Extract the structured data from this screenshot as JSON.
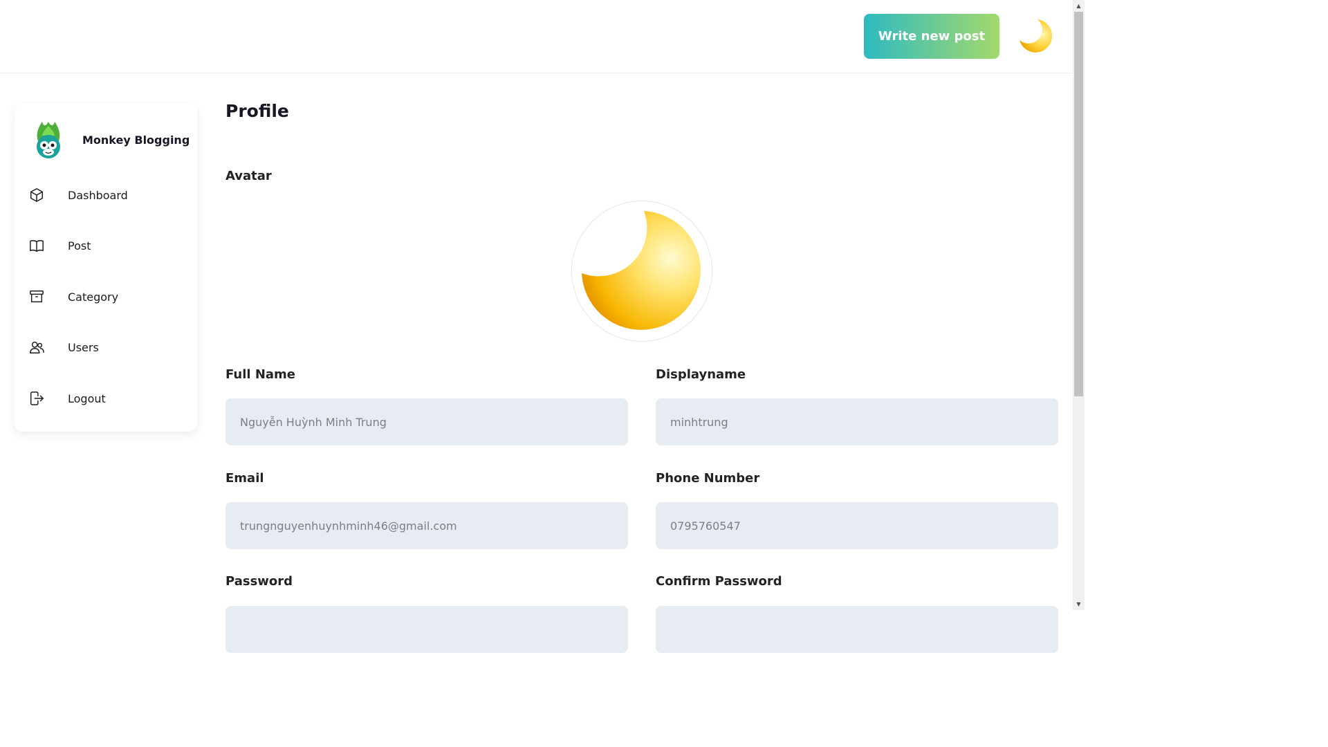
{
  "header": {
    "write_button": "Write new post",
    "avatar_icon": "crescent-moon"
  },
  "sidebar": {
    "brand_name": "Monkey Blogging",
    "items": [
      {
        "label": "Dashboard",
        "icon": "cube-icon"
      },
      {
        "label": "Post",
        "icon": "book-icon"
      },
      {
        "label": "Category",
        "icon": "archive-icon"
      },
      {
        "label": "Users",
        "icon": "users-icon"
      },
      {
        "label": "Logout",
        "icon": "logout-icon"
      }
    ]
  },
  "main": {
    "title": "Profile",
    "avatar_label": "Avatar",
    "fields": {
      "full_name": {
        "label": "Full Name",
        "value": "Nguyễn Huỳnh Minh Trung"
      },
      "display_name": {
        "label": "Displayname",
        "value": "minhtrung"
      },
      "email": {
        "label": "Email",
        "value": "trungnguyenhuynhminh46@gmail.com"
      },
      "phone": {
        "label": "Phone Number",
        "value": "0795760547"
      },
      "password": {
        "label": "Password",
        "value": ""
      },
      "confirm_password": {
        "label": "Confirm Password",
        "value": ""
      }
    }
  },
  "colors": {
    "button_gradient_start": "#2ebac1",
    "button_gradient_end": "#a4d96c",
    "input_bg": "#e7ecf3"
  }
}
